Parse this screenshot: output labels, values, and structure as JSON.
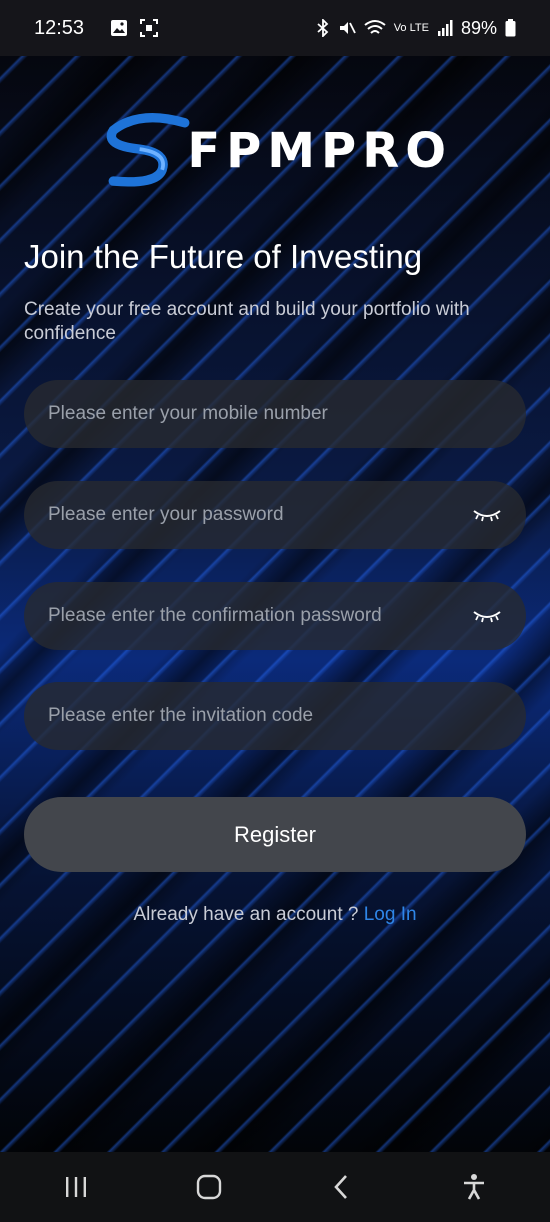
{
  "status_bar": {
    "time": "12:53",
    "battery": "89%",
    "network": "Vo LTE"
  },
  "logo": {
    "text": "FPΜPRO",
    "accent": "#1e73d8"
  },
  "header": {
    "title": "Join the Future of Investing",
    "subtitle": "Create your free account and build your portfolio with confidence"
  },
  "form": {
    "mobile_placeholder": "Please enter your mobile number",
    "password_placeholder": "Please enter your password",
    "confirm_placeholder": "Please enter the confirmation password",
    "invite_placeholder": "Please enter the invitation code",
    "register_label": "Register"
  },
  "footer": {
    "prompt": "Already have an account ? ",
    "login_label": "Log In",
    "link_color": "#2f86e8"
  },
  "icons": {
    "eye": "eye-closed-icon",
    "recent": "recent-apps-icon",
    "home": "home-icon",
    "back": "back-icon",
    "accessibility": "accessibility-icon"
  }
}
